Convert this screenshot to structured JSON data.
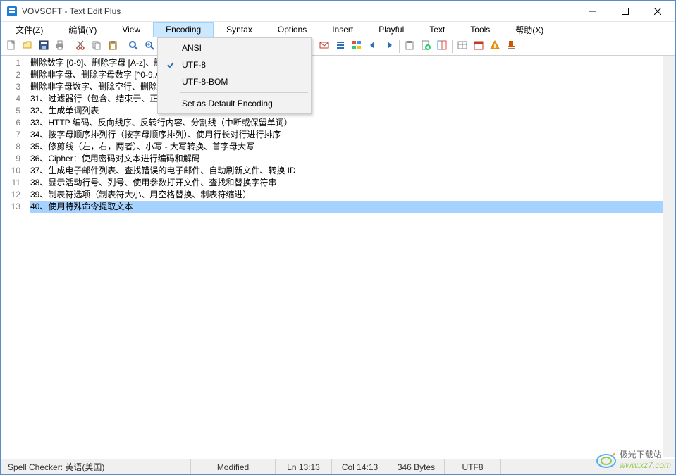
{
  "window": {
    "title": "VOVSOFT - Text Edit Plus"
  },
  "menubar": [
    {
      "label": "文件(Z)"
    },
    {
      "label": "编辑(Y)"
    },
    {
      "label": "View"
    },
    {
      "label": "Encoding",
      "active": true
    },
    {
      "label": "Syntax"
    },
    {
      "label": "Options"
    },
    {
      "label": "Insert"
    },
    {
      "label": "Playful"
    },
    {
      "label": "Text"
    },
    {
      "label": "Tools"
    },
    {
      "label": "帮助(X)"
    }
  ],
  "dropdown": {
    "items": [
      {
        "label": "ANSI",
        "checked": false
      },
      {
        "label": "UTF-8",
        "checked": true
      },
      {
        "label": "UTF-8-BOM",
        "checked": false
      }
    ],
    "sep": true,
    "footer": {
      "label": "Set as Default Encoding"
    }
  },
  "toolbar_icons": [
    "new",
    "open",
    "save",
    "print",
    "|",
    "cut",
    "copy",
    "paste",
    "|",
    "find",
    "zoom-in",
    "zoom-out",
    "|",
    "undo",
    "redo",
    "|",
    "bullet-red",
    "bullet-teal",
    "bullet-gray",
    "link",
    "|",
    "wand",
    "funnel",
    "mail",
    "lines",
    "palette",
    "left",
    "right",
    "|",
    "clipboard",
    "doc-plus",
    "doc-compare",
    "|",
    "table",
    "calendar",
    "warning",
    "stamp"
  ],
  "lines": [
    "删除数字 [0-9]、删除字母 [A-z]、删除非字母 [^A-z]",
    "删除非字母、删除字母数字 [^0-9,A-z]、删除非字母数字 [^0-9,A-z]",
    "删除非字母数字、删除空行、删除多余空格",
    "31、过滤器行（包含、结束于、正则表达式、开始于）",
    "32、生成单词列表",
    "33、HTTP 编码、反向线序、反转行内容、分割线（中断或保留单词）",
    "34、按字母顺序排列行（按字母顺序排列）、使用行长对行进行排序",
    "35、修剪线（左，右，两者）、小写 - 大写转换、首字母大写",
    "36、Cipher：使用密码对文本进行编码和解码",
    "37、生成电子邮件列表、查找错误的电子邮件、自动刷新文件、转换 ID",
    "38、显示活动行号、列号、使用参数打开文件、查找和替换字符串",
    "39、制表符选项（制表符大小、用空格替换、制表符缩进）",
    "40、使用特殊命令提取文本"
  ],
  "selected_line_index": 12,
  "statusbar": {
    "spell": "Spell Checker: 英语(美国)",
    "modified": "Modified",
    "ln": "Ln 13:13",
    "col": "Col 14:13",
    "bytes": "346 Bytes",
    "enc": "UTF8"
  },
  "watermark": {
    "cn": "极光下载站",
    "url": "www.xz7.com"
  }
}
